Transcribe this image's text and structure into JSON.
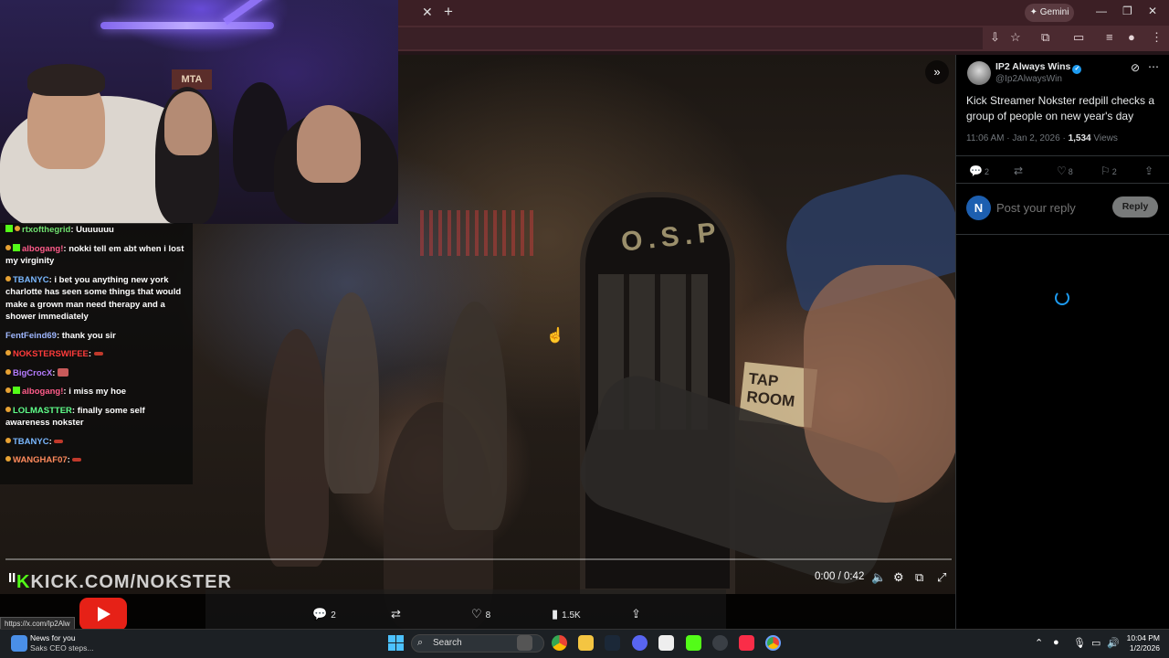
{
  "browser": {
    "gemini_label": "✦ Gemini"
  },
  "chat": {
    "messages": [
      {
        "user": "rtxofthegrid",
        "text": ": Uuuuuuu",
        "color": "#6fe06f"
      },
      {
        "user": "albogang!",
        "text": ": nokki tell em abt when i lost my virginity",
        "color": "#ff5c8a"
      },
      {
        "user": "TBANYC",
        "text": ": i bet you anything new york charlotte has seen some things that would make a grown man need therapy and a shower immediately",
        "color": "#7ab8ff"
      },
      {
        "user": "FentFeind69",
        "text": ": thank you sir",
        "color": "#9fb7ff"
      },
      {
        "user": "NOKSTERSWIFEE",
        "text": ":",
        "color": "#ff3b3b"
      },
      {
        "user": "BigCrocX",
        "text": ":",
        "color": "#b57cff"
      },
      {
        "user": "albogang!",
        "text": ": i miss my hoe",
        "color": "#ff5c8a"
      },
      {
        "user": "LOLMASTTER",
        "text": ": finally some self awareness nokster",
        "color": "#5fff8a"
      },
      {
        "user": "TBANYC",
        "text": ":",
        "color": "#7ab8ff"
      },
      {
        "user": "WANGHAF07",
        "text": ":",
        "color": "#ff8a5c"
      }
    ]
  },
  "video": {
    "watermark_prefix": "K",
    "watermark_rest": "KICK.COM/NOKSTER",
    "sign_osp": "O.S.P",
    "sign_taproom": "TAP ROOM",
    "webcam_sign": "MTA",
    "time": "0:00 / 0:42",
    "pause_symbol": "II",
    "progress": 0
  },
  "tweet_actions_bar": {
    "replies": "2",
    "reposts": "",
    "likes": "8",
    "views": "1.5K"
  },
  "status_url": "https://x.com/Ip2Alw",
  "tweet": {
    "author_name": "IP2 Always Wins",
    "author_handle": "@Ip2AlwaysWin",
    "text": "Kick Streamer Nokster redpill checks a group of people on new year's day",
    "time": "11:06 AM · Jan 2, 2026 · ",
    "views_count": "1,534",
    "views_label": " Views",
    "replies": "2",
    "likes": "8",
    "bookmarks": "2",
    "reply_avatar_letter": "N",
    "reply_placeholder": "Post your reply",
    "reply_button": "Reply"
  },
  "taskbar": {
    "news_title": "News for you",
    "news_sub": "Saks CEO steps...",
    "search_label": "Search",
    "time": "10:04 PM",
    "date": "1/2/2026"
  },
  "colors": {
    "accent_blue": "#1d9bf0",
    "kick_green": "#53fc18",
    "youtube_red": "#e62117"
  }
}
